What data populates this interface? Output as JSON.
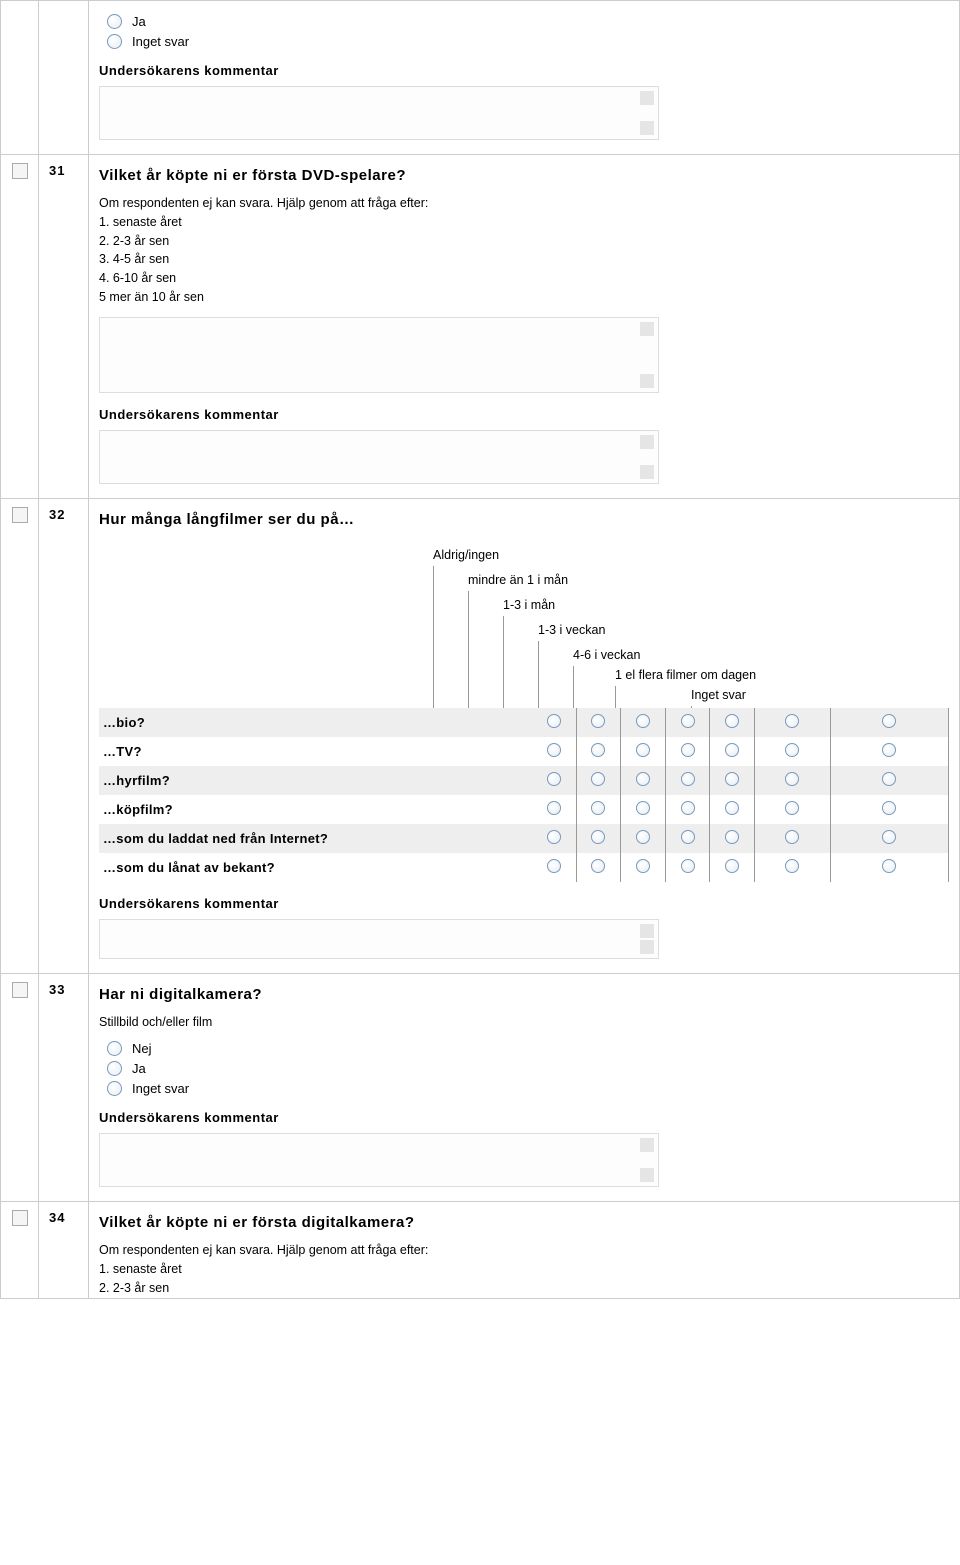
{
  "common": {
    "comment_label": "Undersökarens kommentar"
  },
  "q30_tail": {
    "options": [
      "Ja",
      "Inget svar"
    ]
  },
  "q31": {
    "num": "31",
    "title": "Vilket år köpte ni er första DVD-spelare?",
    "help": "Om respondenten ej kan svara. Hjälp genom att fråga efter:\n1. senaste året\n2. 2-3 år sen\n3. 4-5 år sen\n4. 6-10 år sen\n5 mer än 10 år sen"
  },
  "q32": {
    "num": "32",
    "title": "Hur många långfilmer ser du på…",
    "columns": [
      "Aldrig/ingen",
      "mindre än 1 i mån",
      "1-3 i mån",
      "1-3 i veckan",
      "4-6 i veckan",
      "1 el flera filmer om dagen",
      "Inget svar"
    ],
    "rows": [
      "…bio?",
      "…TV?",
      "…hyrfilm?",
      "…köpfilm?",
      "…som du laddat ned från Internet?",
      "…som du lånat av bekant?"
    ]
  },
  "q33": {
    "num": "33",
    "title": "Har ni digitalkamera?",
    "subtitle": "Stillbild och/eller film",
    "options": [
      "Nej",
      "Ja",
      "Inget svar"
    ]
  },
  "q34": {
    "num": "34",
    "title": "Vilket år köpte ni er första digitalkamera?",
    "help": "Om respondenten ej kan svara. Hjälp genom att fråga efter:\n1. senaste året\n2. 2-3 år sen"
  }
}
